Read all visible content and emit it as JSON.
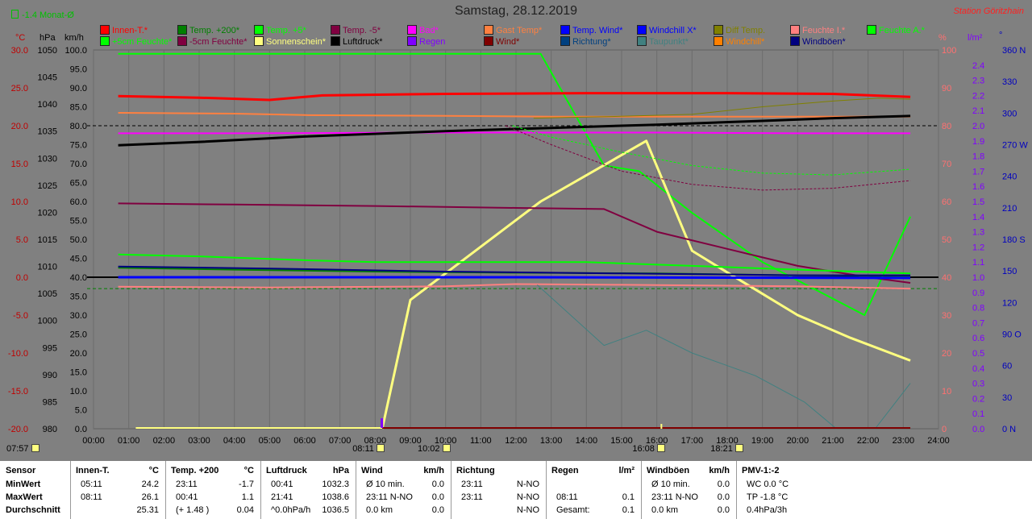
{
  "header": {
    "title": "Samstag, 28.12.2019",
    "station": "Station Göritzhain",
    "monat": "-1.4 Monat-Ø"
  },
  "axis_heads": {
    "temp": "°C",
    "hpa": "hPa",
    "kmh": "km/h",
    "pct": "%",
    "lm2": "l/m²",
    "deg": "°"
  },
  "legend_row1": [
    {
      "label": "Innen-T.*",
      "color": "#ff0000"
    },
    {
      "label": "Temp. +200*",
      "color": "#008000"
    },
    {
      "label": "Temp. +5*",
      "color": "#00ff00"
    },
    {
      "label": "Temp. -5*",
      "color": "#800040"
    },
    {
      "label": "Bad*",
      "color": "#ff00ff"
    },
    {
      "label": "Gast Temp*",
      "color": "#ff8040"
    },
    {
      "label": "Temp. Wind*",
      "color": "#0000ff"
    },
    {
      "label": "Windchill X*",
      "color": "#0000ff"
    },
    {
      "label": "Diff Temp.",
      "color": "#808000"
    },
    {
      "label": "Feuchte I.*",
      "color": "#ff8080"
    },
    {
      "label": "Feuchte A.*",
      "color": "#00ff00"
    }
  ],
  "legend_row2": [
    {
      "label": "+5cm Feuchte*",
      "color": "#00ff00"
    },
    {
      "label": "-5cm Feuchte*",
      "color": "#800040"
    },
    {
      "label": "Sonnenschein*",
      "color": "#ffff80"
    },
    {
      "label": "Luftdruck*",
      "color": "#000000"
    },
    {
      "label": "Regen",
      "color": "#8000ff"
    },
    {
      "label": "Wind*",
      "color": "#800000"
    },
    {
      "label": "Richtung*",
      "color": "#004080"
    },
    {
      "label": "Taupunkt*",
      "color": "#408080"
    },
    {
      "label": "Windchill*",
      "color": "#ff8000"
    },
    {
      "label": "Windböen*",
      "color": "#000080"
    }
  ],
  "chart_data": {
    "type": "line",
    "x_ticks": [
      "00:00",
      "01:00",
      "02:00",
      "03:00",
      "04:00",
      "05:00",
      "06:00",
      "07:00",
      "08:00",
      "09:00",
      "10:00",
      "11:00",
      "12:00",
      "13:00",
      "14:00",
      "15:00",
      "16:00",
      "17:00",
      "18:00",
      "19:00",
      "20:00",
      "21:00",
      "22:00",
      "23:00",
      "24:00"
    ],
    "xlim": [
      0,
      24
    ],
    "axes": {
      "temp": {
        "range": [
          -20,
          30
        ],
        "ticks": [
          "30.0",
          "25.0",
          "20.0",
          "15.0",
          "10.0",
          "5.0",
          "0.0",
          "-5.0",
          "-10.0",
          "-15.0",
          "-20.0"
        ],
        "color": "#c00000"
      },
      "hpa": {
        "range": [
          980,
          1050
        ],
        "ticks": [
          "1050",
          "1045",
          "1040",
          "1035",
          "1030",
          "1025",
          "1020",
          "1015",
          "1010",
          "1005",
          "1000",
          "995",
          "990",
          "985",
          "980"
        ],
        "color": "#000000"
      },
      "kmh": {
        "range": [
          0,
          100
        ],
        "ticks": [
          "100.0",
          "95.0",
          "90.0",
          "85.0",
          "80.0",
          "75.0",
          "70.0",
          "65.0",
          "60.0",
          "55.0",
          "50.0",
          "45.0",
          "40.0",
          "35.0",
          "30.0",
          "25.0",
          "20.0",
          "15.0",
          "10.0",
          "5.0",
          "0.0"
        ],
        "color": "#000000"
      },
      "pct": {
        "range": [
          0,
          100
        ],
        "ticks": [
          "100",
          "90",
          "80",
          "70",
          "60",
          "50",
          "40",
          "30",
          "20",
          "10",
          "0"
        ],
        "color": "#ff7070"
      },
      "lm2": {
        "range": [
          0,
          2.5
        ],
        "ticks": [
          "2.4",
          "2.3",
          "2.2",
          "2.1",
          "2.0",
          "1.9",
          "1.8",
          "1.7",
          "1.6",
          "1.5",
          "1.4",
          "1.3",
          "1.2",
          "1.1",
          "1.0",
          "0.9",
          "0.8",
          "0.7",
          "0.6",
          "0.5",
          "0.4",
          "0.3",
          "0.2",
          "0.1",
          "0.0"
        ],
        "color": "#8000ff"
      },
      "deg": {
        "range": [
          0,
          360
        ],
        "ticks": [
          "360 N",
          "330",
          "300",
          "270 W",
          "240",
          "210",
          "180 S",
          "150",
          "120",
          "90 O",
          "60",
          "30",
          "0 N"
        ],
        "color": "#0000c0"
      }
    },
    "series": [
      {
        "name": "Feuchte A.*",
        "color": "#00ff00",
        "axis": "pct",
        "width": 2,
        "points": [
          [
            0.7,
            99
          ],
          [
            12.7,
            99
          ],
          [
            14.5,
            69.5
          ],
          [
            15.5,
            68
          ],
          [
            17,
            57
          ],
          [
            19,
            44
          ],
          [
            21.9,
            30
          ],
          [
            23.2,
            56
          ]
        ]
      },
      {
        "name": "Sonnenschein*",
        "color": "#ffff80",
        "axis": "pct",
        "width": 3,
        "points": [
          [
            8.2,
            0
          ],
          [
            9.0,
            34
          ],
          [
            12.7,
            60
          ],
          [
            15.7,
            76
          ],
          [
            17.0,
            47
          ],
          [
            18.4,
            39
          ],
          [
            20.0,
            30
          ],
          [
            21.5,
            24
          ],
          [
            23.2,
            18
          ]
        ]
      },
      {
        "name": "Innen-T.*",
        "color": "#ff0000",
        "axis": "temp",
        "width": 3,
        "points": [
          [
            0.7,
            23.9
          ],
          [
            3,
            23.7
          ],
          [
            5,
            23.4
          ],
          [
            6.5,
            24.0
          ],
          [
            10,
            24.2
          ],
          [
            14,
            24.3
          ],
          [
            18,
            24.3
          ],
          [
            21,
            24.2
          ],
          [
            23.2,
            23.8
          ]
        ]
      },
      {
        "name": "Gast Temp*",
        "color": "#ff8040",
        "axis": "temp",
        "width": 2,
        "points": [
          [
            0.7,
            21.7
          ],
          [
            4,
            21.6
          ],
          [
            6,
            21.4
          ],
          [
            10,
            21.3
          ],
          [
            13,
            21.2
          ],
          [
            18,
            21.2
          ],
          [
            23.2,
            21.2
          ]
        ]
      },
      {
        "name": "Bad*",
        "color": "#ff00ff",
        "axis": "temp",
        "width": 2,
        "points": [
          [
            0.7,
            19.0
          ],
          [
            4,
            19.0
          ],
          [
            10,
            19.1
          ],
          [
            16,
            19.1
          ],
          [
            20,
            19.0
          ],
          [
            23.2,
            19.0
          ]
        ]
      },
      {
        "name": "Luftdruck*",
        "color": "#000000",
        "axis": "hpa",
        "width": 3,
        "points": [
          [
            0.7,
            1032.4
          ],
          [
            3,
            1033.0
          ],
          [
            6,
            1034.0
          ],
          [
            10,
            1035.0
          ],
          [
            13,
            1035.6
          ],
          [
            16,
            1036.2
          ],
          [
            19,
            1036.9
          ],
          [
            21,
            1037.4
          ],
          [
            23.2,
            1037.8
          ]
        ]
      },
      {
        "name": "Diff Temp.",
        "color": "#808000",
        "axis": "kmh",
        "width": 1,
        "points": [
          [
            12.5,
            82
          ],
          [
            15,
            82.5
          ],
          [
            17,
            83
          ],
          [
            19,
            85
          ],
          [
            21,
            86.5
          ],
          [
            22.3,
            87.3
          ],
          [
            23.2,
            87
          ]
        ]
      },
      {
        "name": "Temp. -5*",
        "color": "#800040",
        "axis": "kmh",
        "width": 2,
        "points": [
          [
            0.7,
            59.5
          ],
          [
            4,
            59.2
          ],
          [
            8,
            58.8
          ],
          [
            12,
            58.3
          ],
          [
            14.5,
            58.0
          ],
          [
            16,
            52
          ],
          [
            18,
            47.5
          ],
          [
            20,
            43
          ],
          [
            22,
            40
          ],
          [
            23.2,
            38.5
          ]
        ]
      },
      {
        "name": "Temp. +5*",
        "color": "#00ff00",
        "axis": "kmh",
        "width": 2,
        "points": [
          [
            0.7,
            46
          ],
          [
            3,
            45.5
          ],
          [
            6,
            44.5
          ],
          [
            8,
            44
          ],
          [
            12,
            44
          ],
          [
            14,
            44
          ],
          [
            17,
            43
          ],
          [
            20,
            42
          ],
          [
            23.2,
            41
          ]
        ]
      },
      {
        "name": "Temp. +200*",
        "color": "#008000",
        "axis": "kmh",
        "width": 2,
        "points": [
          [
            0.7,
            42.5
          ],
          [
            4,
            42
          ],
          [
            8,
            41.5
          ],
          [
            12,
            41.2
          ],
          [
            16,
            41.0
          ],
          [
            20,
            40.5
          ],
          [
            23.2,
            40.3
          ]
        ]
      },
      {
        "name": "Windböen*",
        "color": "#000080",
        "axis": "kmh",
        "width": 2,
        "points": [
          [
            0.7,
            42.8
          ],
          [
            5,
            42.3
          ],
          [
            10,
            41.5
          ],
          [
            15,
            41
          ],
          [
            20,
            40.5
          ],
          [
            23.2,
            40.5
          ]
        ]
      },
      {
        "name": "Temp. Wind*",
        "color": "#0000ff",
        "axis": "kmh",
        "width": 3,
        "points": [
          [
            0.7,
            40.0
          ],
          [
            12,
            40.0
          ],
          [
            23.2,
            39.8
          ]
        ]
      },
      {
        "name": "Feuchte I.*",
        "color": "#ff8080",
        "axis": "kmh",
        "width": 2,
        "points": [
          [
            0.7,
            37.5
          ],
          [
            5,
            37.3
          ],
          [
            10,
            37.6
          ],
          [
            12,
            38.2
          ],
          [
            15,
            38.0
          ],
          [
            20,
            37.6
          ],
          [
            23.2,
            37.0
          ]
        ]
      },
      {
        "name": "Taupunkt*",
        "color": "#408080",
        "axis": "kmh",
        "width": 1,
        "points": [
          [
            12.6,
            38
          ],
          [
            14.5,
            22
          ],
          [
            15.7,
            26
          ],
          [
            17,
            20
          ],
          [
            18.8,
            14
          ],
          [
            20.2,
            7
          ],
          [
            21.1,
            0
          ]
        ]
      },
      {
        "name": "Taupunkt*",
        "color": "#408080",
        "axis": "kmh",
        "width": 1,
        "points": [
          [
            22.2,
            0
          ],
          [
            23.2,
            12
          ]
        ]
      },
      {
        "name": "Temp. -5*",
        "color": "#800040",
        "axis": "kmh",
        "width": 1,
        "dash": true,
        "points": [
          [
            11.7,
            80
          ],
          [
            13,
            75
          ],
          [
            15,
            68
          ],
          [
            17,
            64.5
          ],
          [
            19,
            63
          ],
          [
            21,
            63.5
          ],
          [
            23.2,
            65.5
          ]
        ]
      },
      {
        "name": "Temp. +5*",
        "color": "#00ff00",
        "axis": "kmh",
        "width": 1,
        "dash": true,
        "points": [
          [
            11.9,
            80
          ],
          [
            13,
            77
          ],
          [
            15,
            73
          ],
          [
            17,
            69.5
          ],
          [
            19,
            67.5
          ],
          [
            21,
            67
          ],
          [
            23.2,
            68.5
          ]
        ]
      }
    ],
    "baselines": [
      {
        "color": "#000000",
        "y": 80,
        "width": 1,
        "dash": true
      },
      {
        "color": "#000000",
        "y": 40,
        "width": 2
      },
      {
        "color": "#008000",
        "y": 37,
        "width": 1,
        "dash": true
      }
    ],
    "markers": [
      {
        "label": "08:11",
        "x": 8.18
      },
      {
        "label": "10:02",
        "x": 10.03
      },
      {
        "label": "16:08",
        "x": 16.13
      },
      {
        "label": "18:21",
        "x": 18.35
      }
    ],
    "corner_time": "07:57"
  },
  "table": {
    "row_labels": [
      "Sensor",
      "MinWert",
      "MaxWert",
      "Durchschnitt"
    ],
    "columns": [
      {
        "header": "Innen-T.",
        "unit": "°C",
        "rows": [
          [
            "05:11",
            "24.2"
          ],
          [
            "08:11",
            "26.1"
          ],
          [
            "",
            "25.31"
          ]
        ]
      },
      {
        "header": "Temp. +200",
        "unit": "°C",
        "rows": [
          [
            "23:11",
            "-1.7"
          ],
          [
            "00:41",
            "1.1"
          ],
          [
            "(+ 1.48 )",
            "0.04"
          ]
        ]
      },
      {
        "header": "Luftdruck",
        "unit": "hPa",
        "rows": [
          [
            "00:41",
            "1032.3"
          ],
          [
            "21:41",
            "1038.6"
          ],
          [
            "^0.0hPa/h",
            "1036.5"
          ]
        ]
      },
      {
        "header": "Wind",
        "unit": "km/h",
        "rows": [
          [
            "Ø 10 min.",
            "0.0"
          ],
          [
            "23:11  N-NO",
            "0.0"
          ],
          [
            "0.0 km",
            "0.0"
          ]
        ]
      },
      {
        "header": "Richtung",
        "unit": "",
        "rows": [
          [
            "23:11",
            "N-NO"
          ],
          [
            "23:11",
            "N-NO"
          ],
          [
            "",
            "N-NO"
          ]
        ]
      },
      {
        "header": "Regen",
        "unit": "l/m²",
        "rows": [
          [
            "",
            ""
          ],
          [
            "08:11",
            "0.1"
          ],
          [
            "Gesamt:",
            "0.1"
          ]
        ]
      },
      {
        "header": "Windböen",
        "unit": "km/h",
        "rows": [
          [
            "Ø 10 min.",
            "0.0"
          ],
          [
            "23:11  N-NO",
            "0.0"
          ],
          [
            "0.0 km",
            "0.0"
          ]
        ]
      },
      {
        "header": "PMV-1:-2",
        "unit": "",
        "rows": [
          [
            "WC 0.0 °C",
            ""
          ],
          [
            "TP -1.8 °C",
            ""
          ],
          [
            "0.4hPa/3h",
            ""
          ]
        ]
      }
    ]
  }
}
